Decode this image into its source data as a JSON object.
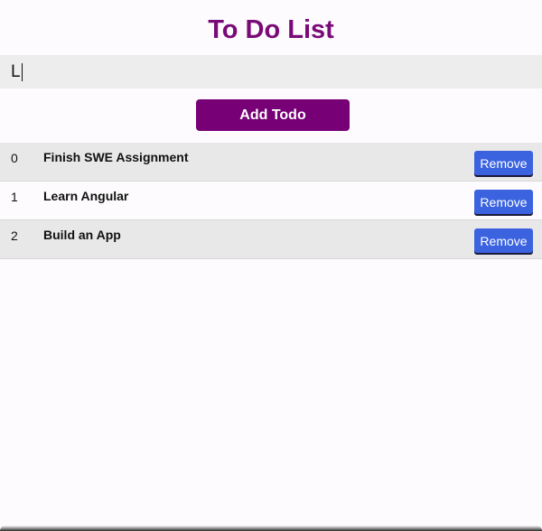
{
  "app": {
    "title": "To Do List"
  },
  "input": {
    "value": "L",
    "placeholder": ""
  },
  "add_button": {
    "label": "Add Todo"
  },
  "todos": [
    {
      "index": "0",
      "text": "Finish SWE Assignment",
      "remove_label": "Remove"
    },
    {
      "index": "1",
      "text": "Learn Angular",
      "remove_label": "Remove"
    },
    {
      "index": "2",
      "text": "Build an App",
      "remove_label": "Remove"
    }
  ],
  "colors": {
    "title": "#7a0a78",
    "add_button": "#770077",
    "remove_button": "#3b63e0",
    "row_alt": "#e8e8e9"
  }
}
